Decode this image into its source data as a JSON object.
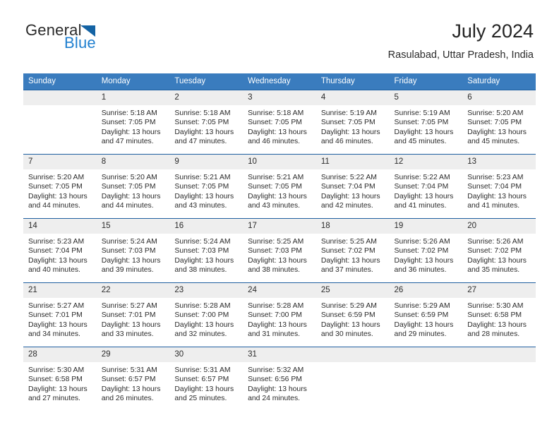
{
  "brand": {
    "name_part1": "General",
    "name_part2": "Blue",
    "logo_icon": "blue-triangle-logo"
  },
  "header": {
    "title": "July 2024",
    "subtitle": "Rasulabad, Uttar Pradesh, India"
  },
  "colors": {
    "header_blue": "#3a7cbe",
    "row_border_blue": "#1f5fa0",
    "daynum_band": "#eeeeee",
    "brand_blue": "#1f7fcf",
    "text": "#2b2b2b"
  },
  "calendar": {
    "weekday_headers": [
      "Sunday",
      "Monday",
      "Tuesday",
      "Wednesday",
      "Thursday",
      "Friday",
      "Saturday"
    ],
    "weeks": [
      [
        {
          "day": "",
          "sunrise": "",
          "sunset": "",
          "daylight_line1": "",
          "daylight_line2": "",
          "empty": true
        },
        {
          "day": "1",
          "sunrise": "Sunrise: 5:18 AM",
          "sunset": "Sunset: 7:05 PM",
          "daylight_line1": "Daylight: 13 hours",
          "daylight_line2": "and 47 minutes.",
          "empty": false
        },
        {
          "day": "2",
          "sunrise": "Sunrise: 5:18 AM",
          "sunset": "Sunset: 7:05 PM",
          "daylight_line1": "Daylight: 13 hours",
          "daylight_line2": "and 47 minutes.",
          "empty": false
        },
        {
          "day": "3",
          "sunrise": "Sunrise: 5:18 AM",
          "sunset": "Sunset: 7:05 PM",
          "daylight_line1": "Daylight: 13 hours",
          "daylight_line2": "and 46 minutes.",
          "empty": false
        },
        {
          "day": "4",
          "sunrise": "Sunrise: 5:19 AM",
          "sunset": "Sunset: 7:05 PM",
          "daylight_line1": "Daylight: 13 hours",
          "daylight_line2": "and 46 minutes.",
          "empty": false
        },
        {
          "day": "5",
          "sunrise": "Sunrise: 5:19 AM",
          "sunset": "Sunset: 7:05 PM",
          "daylight_line1": "Daylight: 13 hours",
          "daylight_line2": "and 45 minutes.",
          "empty": false
        },
        {
          "day": "6",
          "sunrise": "Sunrise: 5:20 AM",
          "sunset": "Sunset: 7:05 PM",
          "daylight_line1": "Daylight: 13 hours",
          "daylight_line2": "and 45 minutes.",
          "empty": false
        }
      ],
      [
        {
          "day": "7",
          "sunrise": "Sunrise: 5:20 AM",
          "sunset": "Sunset: 7:05 PM",
          "daylight_line1": "Daylight: 13 hours",
          "daylight_line2": "and 44 minutes.",
          "empty": false
        },
        {
          "day": "8",
          "sunrise": "Sunrise: 5:20 AM",
          "sunset": "Sunset: 7:05 PM",
          "daylight_line1": "Daylight: 13 hours",
          "daylight_line2": "and 44 minutes.",
          "empty": false
        },
        {
          "day": "9",
          "sunrise": "Sunrise: 5:21 AM",
          "sunset": "Sunset: 7:05 PM",
          "daylight_line1": "Daylight: 13 hours",
          "daylight_line2": "and 43 minutes.",
          "empty": false
        },
        {
          "day": "10",
          "sunrise": "Sunrise: 5:21 AM",
          "sunset": "Sunset: 7:05 PM",
          "daylight_line1": "Daylight: 13 hours",
          "daylight_line2": "and 43 minutes.",
          "empty": false
        },
        {
          "day": "11",
          "sunrise": "Sunrise: 5:22 AM",
          "sunset": "Sunset: 7:04 PM",
          "daylight_line1": "Daylight: 13 hours",
          "daylight_line2": "and 42 minutes.",
          "empty": false
        },
        {
          "day": "12",
          "sunrise": "Sunrise: 5:22 AM",
          "sunset": "Sunset: 7:04 PM",
          "daylight_line1": "Daylight: 13 hours",
          "daylight_line2": "and 41 minutes.",
          "empty": false
        },
        {
          "day": "13",
          "sunrise": "Sunrise: 5:23 AM",
          "sunset": "Sunset: 7:04 PM",
          "daylight_line1": "Daylight: 13 hours",
          "daylight_line2": "and 41 minutes.",
          "empty": false
        }
      ],
      [
        {
          "day": "14",
          "sunrise": "Sunrise: 5:23 AM",
          "sunset": "Sunset: 7:04 PM",
          "daylight_line1": "Daylight: 13 hours",
          "daylight_line2": "and 40 minutes.",
          "empty": false
        },
        {
          "day": "15",
          "sunrise": "Sunrise: 5:24 AM",
          "sunset": "Sunset: 7:03 PM",
          "daylight_line1": "Daylight: 13 hours",
          "daylight_line2": "and 39 minutes.",
          "empty": false
        },
        {
          "day": "16",
          "sunrise": "Sunrise: 5:24 AM",
          "sunset": "Sunset: 7:03 PM",
          "daylight_line1": "Daylight: 13 hours",
          "daylight_line2": "and 38 minutes.",
          "empty": false
        },
        {
          "day": "17",
          "sunrise": "Sunrise: 5:25 AM",
          "sunset": "Sunset: 7:03 PM",
          "daylight_line1": "Daylight: 13 hours",
          "daylight_line2": "and 38 minutes.",
          "empty": false
        },
        {
          "day": "18",
          "sunrise": "Sunrise: 5:25 AM",
          "sunset": "Sunset: 7:02 PM",
          "daylight_line1": "Daylight: 13 hours",
          "daylight_line2": "and 37 minutes.",
          "empty": false
        },
        {
          "day": "19",
          "sunrise": "Sunrise: 5:26 AM",
          "sunset": "Sunset: 7:02 PM",
          "daylight_line1": "Daylight: 13 hours",
          "daylight_line2": "and 36 minutes.",
          "empty": false
        },
        {
          "day": "20",
          "sunrise": "Sunrise: 5:26 AM",
          "sunset": "Sunset: 7:02 PM",
          "daylight_line1": "Daylight: 13 hours",
          "daylight_line2": "and 35 minutes.",
          "empty": false
        }
      ],
      [
        {
          "day": "21",
          "sunrise": "Sunrise: 5:27 AM",
          "sunset": "Sunset: 7:01 PM",
          "daylight_line1": "Daylight: 13 hours",
          "daylight_line2": "and 34 minutes.",
          "empty": false
        },
        {
          "day": "22",
          "sunrise": "Sunrise: 5:27 AM",
          "sunset": "Sunset: 7:01 PM",
          "daylight_line1": "Daylight: 13 hours",
          "daylight_line2": "and 33 minutes.",
          "empty": false
        },
        {
          "day": "23",
          "sunrise": "Sunrise: 5:28 AM",
          "sunset": "Sunset: 7:00 PM",
          "daylight_line1": "Daylight: 13 hours",
          "daylight_line2": "and 32 minutes.",
          "empty": false
        },
        {
          "day": "24",
          "sunrise": "Sunrise: 5:28 AM",
          "sunset": "Sunset: 7:00 PM",
          "daylight_line1": "Daylight: 13 hours",
          "daylight_line2": "and 31 minutes.",
          "empty": false
        },
        {
          "day": "25",
          "sunrise": "Sunrise: 5:29 AM",
          "sunset": "Sunset: 6:59 PM",
          "daylight_line1": "Daylight: 13 hours",
          "daylight_line2": "and 30 minutes.",
          "empty": false
        },
        {
          "day": "26",
          "sunrise": "Sunrise: 5:29 AM",
          "sunset": "Sunset: 6:59 PM",
          "daylight_line1": "Daylight: 13 hours",
          "daylight_line2": "and 29 minutes.",
          "empty": false
        },
        {
          "day": "27",
          "sunrise": "Sunrise: 5:30 AM",
          "sunset": "Sunset: 6:58 PM",
          "daylight_line1": "Daylight: 13 hours",
          "daylight_line2": "and 28 minutes.",
          "empty": false
        }
      ],
      [
        {
          "day": "28",
          "sunrise": "Sunrise: 5:30 AM",
          "sunset": "Sunset: 6:58 PM",
          "daylight_line1": "Daylight: 13 hours",
          "daylight_line2": "and 27 minutes.",
          "empty": false
        },
        {
          "day": "29",
          "sunrise": "Sunrise: 5:31 AM",
          "sunset": "Sunset: 6:57 PM",
          "daylight_line1": "Daylight: 13 hours",
          "daylight_line2": "and 26 minutes.",
          "empty": false
        },
        {
          "day": "30",
          "sunrise": "Sunrise: 5:31 AM",
          "sunset": "Sunset: 6:57 PM",
          "daylight_line1": "Daylight: 13 hours",
          "daylight_line2": "and 25 minutes.",
          "empty": false
        },
        {
          "day": "31",
          "sunrise": "Sunrise: 5:32 AM",
          "sunset": "Sunset: 6:56 PM",
          "daylight_line1": "Daylight: 13 hours",
          "daylight_line2": "and 24 minutes.",
          "empty": false
        },
        {
          "day": "",
          "sunrise": "",
          "sunset": "",
          "daylight_line1": "",
          "daylight_line2": "",
          "empty": true
        },
        {
          "day": "",
          "sunrise": "",
          "sunset": "",
          "daylight_line1": "",
          "daylight_line2": "",
          "empty": true
        },
        {
          "day": "",
          "sunrise": "",
          "sunset": "",
          "daylight_line1": "",
          "daylight_line2": "",
          "empty": true
        }
      ]
    ]
  }
}
